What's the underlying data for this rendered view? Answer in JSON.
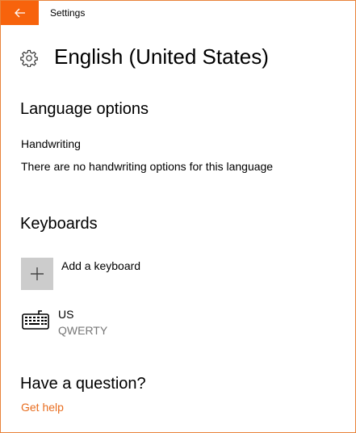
{
  "window": {
    "app_title": "Settings",
    "accent_color": "#f7630c"
  },
  "header": {
    "back_icon": "back-arrow-icon",
    "settings_icon": "gear-icon",
    "page_title": "English (United States)"
  },
  "language_options": {
    "heading": "Language options",
    "handwriting_label": "Handwriting",
    "handwriting_text": "There are no handwriting options for this language"
  },
  "keyboards": {
    "heading": "Keyboards",
    "add_label": "Add a keyboard",
    "add_icon": "plus-icon",
    "items": [
      {
        "icon": "keyboard-icon",
        "name": "US",
        "layout": "QWERTY"
      }
    ]
  },
  "help": {
    "heading": "Have a question?",
    "link_label": "Get help",
    "link_color": "#e86d1f"
  }
}
